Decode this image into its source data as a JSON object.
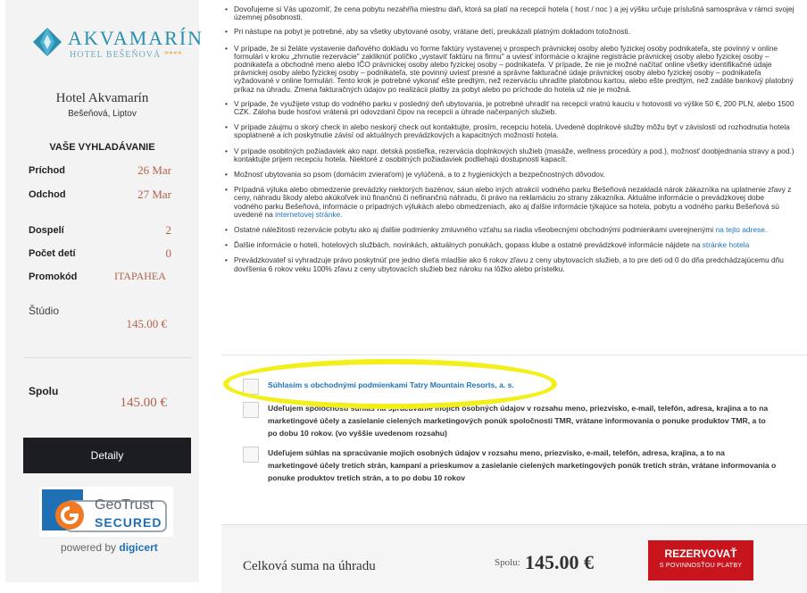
{
  "sidebar": {
    "logo": {
      "brand": "AKVAMARÍN",
      "sub": "HOTEL BEŠEŇOVÁ",
      "stars": "****"
    },
    "hotel_name": "Hotel Akvamarín",
    "hotel_location": "Bešeňová, Liptov",
    "search_title": "VAŠE VYHLADÁVANIE",
    "rows": [
      {
        "label": "Príchod",
        "value": "26 Mar"
      },
      {
        "label": "Odchod",
        "value": "27 Mar"
      },
      {
        "label": "Dospelí",
        "value": "2"
      },
      {
        "label": "Počet detí",
        "value": "0"
      },
      {
        "label": "Promokód",
        "value": "ITAPAHEA"
      }
    ],
    "room_label": "Štúdio",
    "room_price": "145.00 €",
    "total_label": "Spolu",
    "total_price": "145.00 €",
    "details_button": "Detaily",
    "geotrust": {
      "name": "GeoTrust",
      "secured": "SECURED",
      "powered_by": "powered by",
      "powered_brand": "digicert"
    }
  },
  "terms": [
    "Dovoľujeme si Vás upozorniť, že cena pobytu nezahŕňa miestnu daň, ktorá sa platí na recepcii hotela ( host / noc ) a jej výšku určuje príslušná samospráva v rámci svojej územnej pôsobnosti.",
    "Pri nástupe na pobyt je potrebné, aby sa všetky ubytované osoby, vrátane detí, preukázali platným dokladom totožnosti.",
    "V prípade, že si želáte vystavenie daňového dokladu vo forme faktúry vystavenej v prospech právnickej osoby alebo fyzickej osoby podnikateľa, ste povinný v online formulári v kroku „zhrnutie rezervácie\" zakliknúť políčko „vystaviť faktúru na firmu\" a uviesť informácie o krajine registrácie právnickej osoby alebo fyzickej osoby – podnikateľa a obchodné meno alebo IČO právnickej osoby alebo fyzickej osoby – podnikateľa. V prípade, že nie je možné načítať online všetky identifikačné údaje právnickej osoby alebo fyzickej osoby – podnikateľa, ste povinný uviesť presné a správne fakturačné údaje právnickej osoby alebo fyzickej osoby – podnikateľa vyžadované v online formulári. Tento krok je potrebné vykonať ešte predtým, než rezerváciu uhradíte platobnou kartou, alebo ešte predtým, než zadáte bankový platobný príkaz na úhradu. Zmena fakturačných údajov po realizácii platby za pobyt alebo po príchode do hotela už nie je možná.",
    "V prípade, že využijete vstup do vodného parku v posledný deň ubytovania, je potrebné uhradiť na recepcii vratnú kauciu v hotovosti vo výške 50 €, 200 PLN, alebo 1500 CZK. Záloha bude hosťovi vrátená pri odovzdaní čipov na recepcii a úhrade načerpaných služieb.",
    "V prípade záujmu o skorý check in alebo neskorý check out kontaktujte, prosím, recepciu hotela. Uvedené doplnkové služby môžu byť v závislosti od rozhodnutia hotela spoplatnené a ich poskytnutie závisí od aktuálnych prevádzkových a kapacitných možností hotela.",
    "V prípade osobitných požiadaviek ako napr. detská postieľka, rezervácia doplnkových služieb (masáže, wellness procedúry a pod.), možnosť doobjednania stravy a pod.) kontaktujte prijem recepciu hotela. Niektoré z osobitných požiadaviek podliehajú dostupnosti kapacít.",
    "Možnosť ubytovania so psom (domácim zvieraťom) je vylúčená, a to z hygienických a bezpečnostných dôvodov.",
    "Prípadná výluka alebo obmedzenie prevádzky niektorých bazénov, sáun alebo iných atrakcií vodného parku Bešeňová nezakladá nárok zákazníka na uplatnenie zľavy z ceny, náhradu škody alebo akúkoľvek inú finančnú či nefinančnú náhradu, či právo na reklamáciu zo strany zákazníka. Aktuálne informácie o prevádzkovej dobe vodného parku Bešeňová, informácie o prípadných výlukách alebo obmedzeniach, ako aj ďalšie informácie týkajúce sa hotela, pobytu a vodného parku Bešeňová sú uvedené na",
    "Ostatné náležitosti rezervácie pobytu ako aj ďalšie podmienky zmluvného vzťahu sa riadia všeobecnými obchodnými podmienkami uverejnenými",
    "Ďalšie informácie o hoteli, hotelových službách, novinkách, aktuálnych ponukách, gopass klube a ostatné prevádzkové informácie nájdete na",
    "Prevádzkovateľ si vyhradzuje právo poskytnúť pre jedno dieťa mladšie ako 6 rokov zľavu z ceny ubytovacích služieb, a to pre deti od 0 do dňa predchádzajúcemu dňu dovŕšenia 6 rokov veku 100% zľavu z ceny ubytovacích služieb bez nároku na lôžko alebo prístelku."
  ],
  "term_links": {
    "water_park_site": "internetovej stránke.",
    "tos_link": "na tejto adrese.",
    "hotel_page": "stránke hotela"
  },
  "consents": [
    "Súhlasím s obchodnými podmienkami Tatry Mountain Resorts, a. s.",
    "Udeľujem spoločnosti súhlas na spracúvanie mojich osobných údajov v rozsahu meno, priezvisko, e-mail, telefón, adresa, krajina a to na marketingové účely a zasielanie cielených marketingových ponúk spoločnosti TMR, vrátane informovania o ponuke produktov TMR, a to po dobu 10 rokov. (vo vyššie uvedenom rozsahu)",
    "Udeľujem súhlas na spracúvanie mojich osobných údajov v rozsahu meno, priezvisko, e-mail, telefón, adresa, krajina, a to na marketingové účely tretích strán, kampaní a prieskumov a zasielanie cielených marketingových ponúk tretích strán, vrátane informovania o ponuke produktov tretích strán, a to po dobu 10 rokov"
  ],
  "footer": {
    "total_label": "Celková suma na úhradu",
    "spolu": "Spolu:",
    "amount": "145.00 €",
    "reserve_main": "REZERVOVAŤ",
    "reserve_sub": "S POVINNOSŤOU PLATBY"
  },
  "colors": {
    "accent": "#b5614a",
    "link": "#1f73b7",
    "reserve": "#c8141c",
    "highlight": "#f2ef1a"
  }
}
